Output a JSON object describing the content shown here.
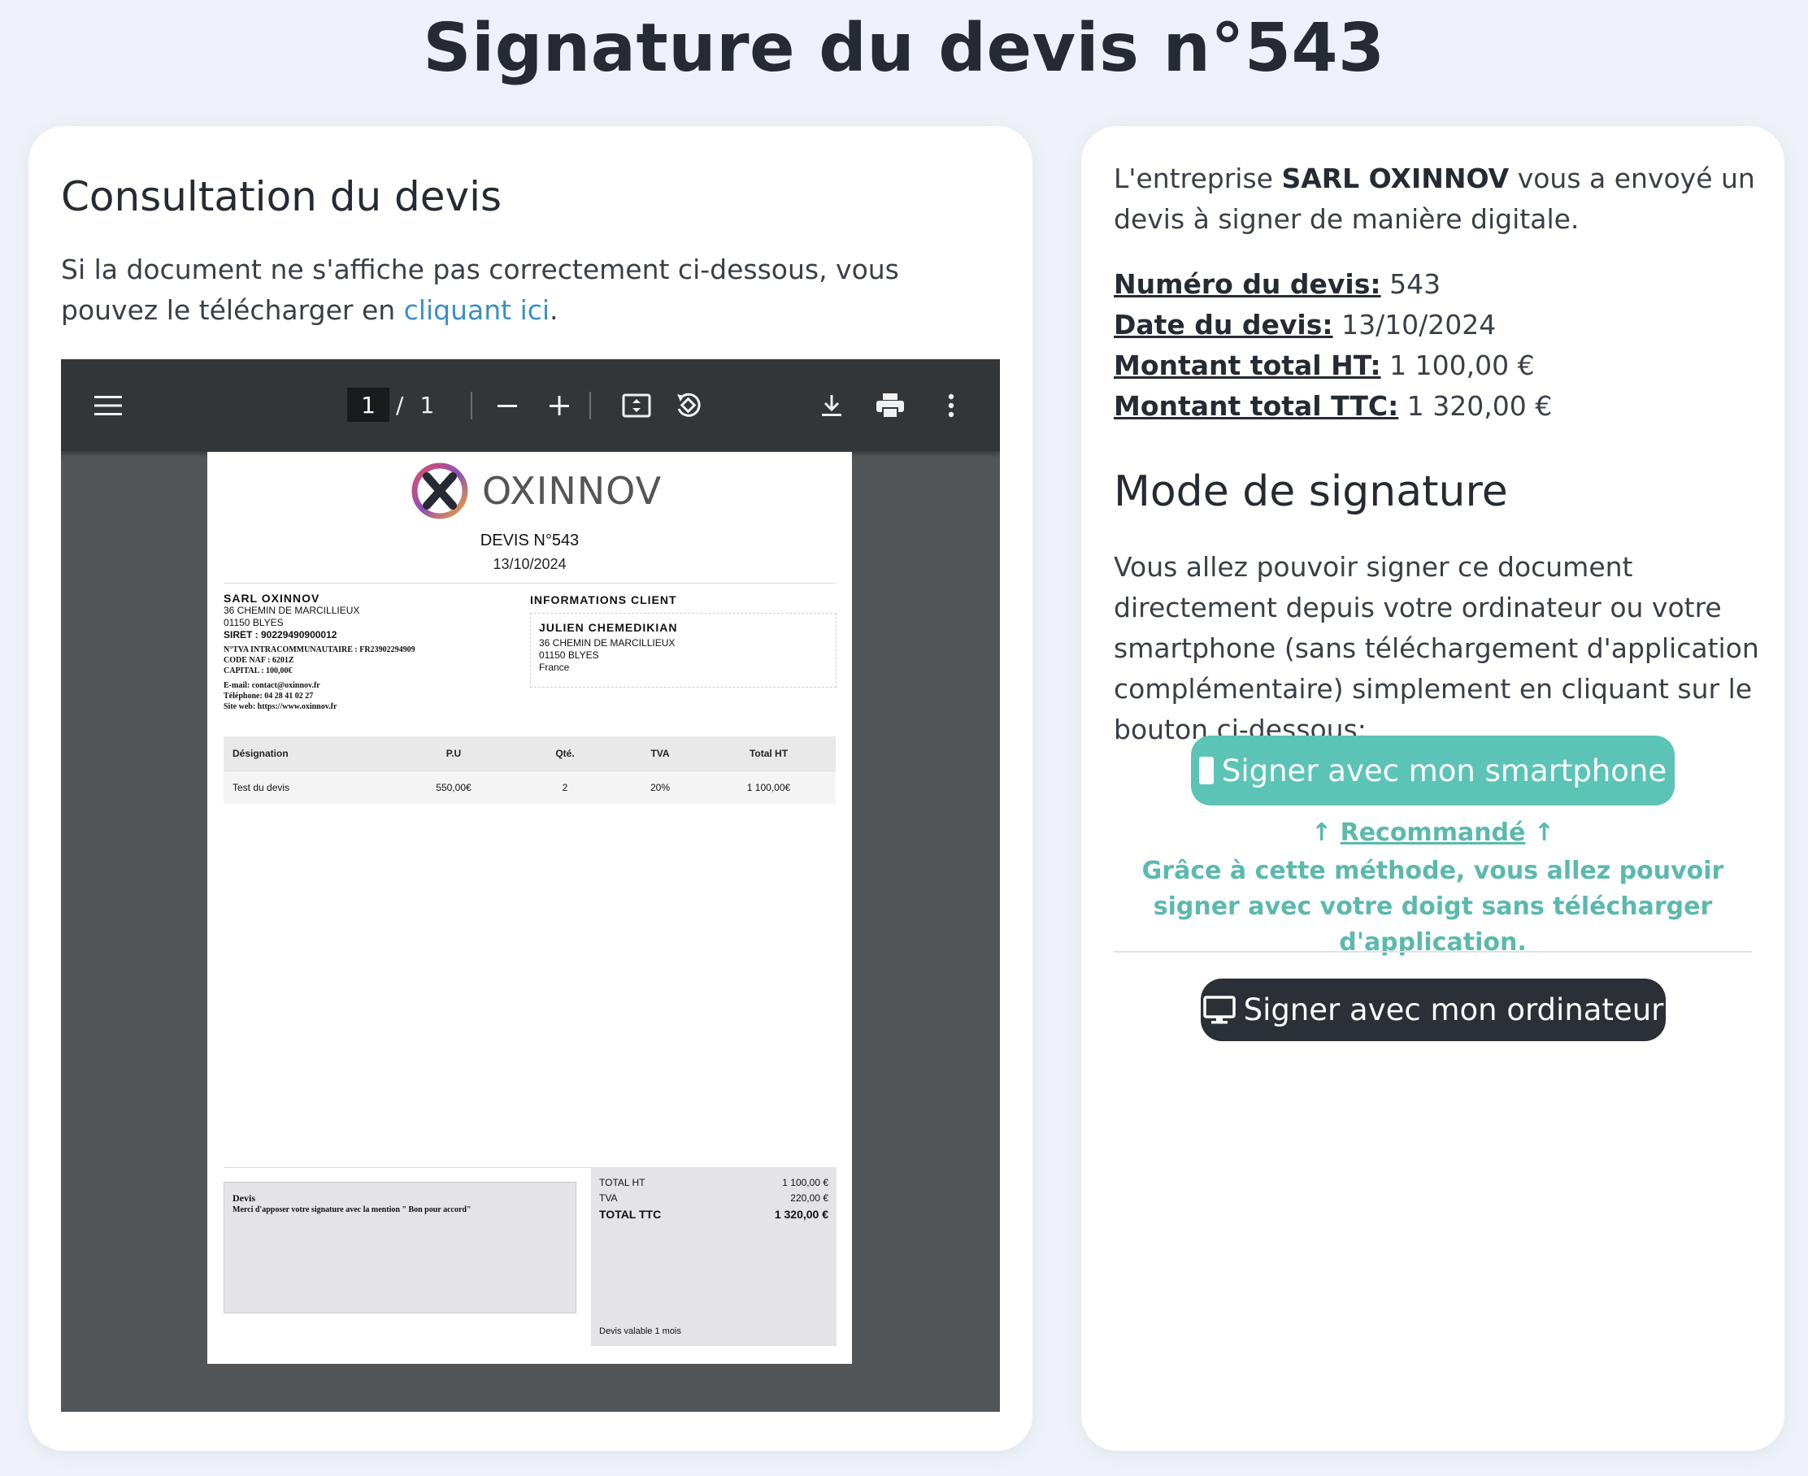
{
  "page": {
    "title": "Signature du devis n°543"
  },
  "left": {
    "heading": "Consultation du devis",
    "intro_before": "Si la document ne s'affiche pas correctement ci-dessous, vous pouvez le télécharger en ",
    "intro_link": "cliquant ici",
    "intro_after": "."
  },
  "viewer": {
    "current_page": "1",
    "page_separator": "/",
    "total_pages": "1",
    "icons": [
      "menu-icon",
      "zoom-out-icon",
      "zoom-in-icon",
      "fit-page-icon",
      "rotate-icon",
      "download-icon",
      "print-icon",
      "more-vert-icon"
    ]
  },
  "doc": {
    "logo_text": "OXINNOV",
    "title": "DEVIS N°543",
    "date": "13/10/2024",
    "sender": {
      "name": "SARL OXINNOV",
      "address1": "36 CHEMIN DE MARCILLIEUX",
      "address2": "01150 BLYES",
      "siret": "SIRET : 90229490900012",
      "tva": "N°TVA INTRACOMMUNAUTAIRE : FR23902294909",
      "naf": "CODE NAF : 6201Z",
      "capital": "CAPITAL : 100,00€",
      "email": "E-mail: contact@oxinnov.fr",
      "phone": "Téléphone: 04 28 41 02 27",
      "web": "Site web: https://www.oxinnov.fr"
    },
    "client": {
      "heading": "INFORMATIONS CLIENT",
      "name": "JULIEN CHEMEDIKIAN",
      "address1": "36 CHEMIN DE MARCILLIEUX",
      "address2": "01150 BLYES",
      "country": "France"
    },
    "table": {
      "headers": [
        "Désignation",
        "P.U",
        "Qté.",
        "TVA",
        "Total HT"
      ],
      "rows": [
        [
          "Test du devis",
          "550,00€",
          "2",
          "20%",
          "1 100,00€"
        ]
      ]
    },
    "note": {
      "title": "Devis",
      "text": "Merci d'apposer votre signature avec la mention \" Bon pour accord\""
    },
    "totals": {
      "ht_label": "TOTAL HT",
      "ht_value": "1 100,00 €",
      "tva_label": "TVA",
      "tva_value": "220,00 €",
      "ttc_label": "TOTAL TTC",
      "ttc_value": "1 320,00 €",
      "validity": "Devis valable 1 mois"
    }
  },
  "right": {
    "intro_before": "L'entreprise ",
    "company": "SARL OXINNOV",
    "intro_after": " vous a envoyé un devis à signer de manière digitale.",
    "facts": [
      {
        "label": "Numéro du devis:",
        "value": "543"
      },
      {
        "label": "Date du devis:",
        "value": "13/10/2024"
      },
      {
        "label": "Montant total HT:",
        "value": "1 100,00 €"
      },
      {
        "label": "Montant total TTC:",
        "value": "1 320,00 €"
      }
    ],
    "heading": "Mode de signature",
    "description": "Vous allez pouvoir signer ce document directement depuis votre ordinateur ou votre smartphone (sans téléchargement d'application complémentaire) simplement en cliquant sur le bouton ci-dessous:",
    "phone_button": "Signer avec mon smartphone",
    "recommended": "Recommandé",
    "recommended_desc": "Grâce à cette méthode, vous allez pouvoir signer avec votre doigt sans télécharger d'application.",
    "pc_button": "Signer avec mon ordinateur"
  },
  "colors": {
    "accent": "#5bc4b6",
    "dark": "#2b2f36",
    "link": "#3a8fc8",
    "viewer_bg": "#525659",
    "toolbar": "#323639"
  }
}
